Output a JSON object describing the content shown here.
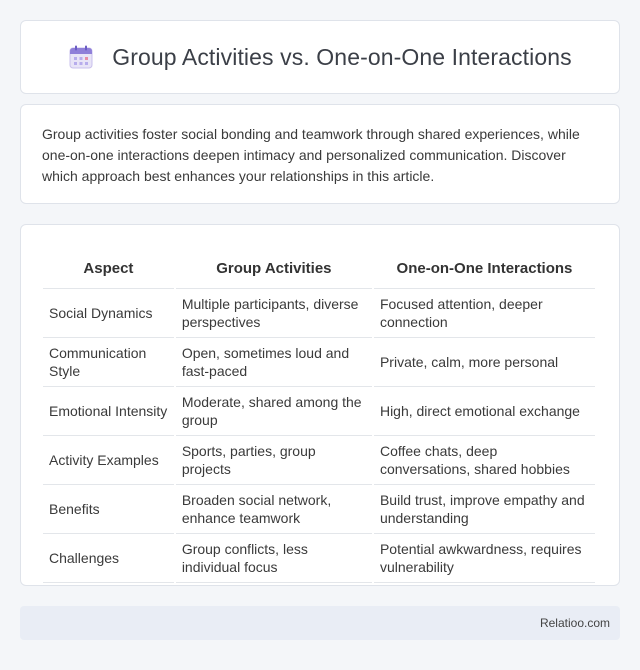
{
  "header": {
    "title": "Group Activities vs. One-on-One Interactions",
    "icon": "calendar-icon"
  },
  "intro": {
    "text": "Group activities foster social bonding and teamwork through shared experiences, while one-on-one interactions deepen intimacy and personalized communication. Discover which approach best enhances your relationships in this article."
  },
  "table": {
    "headers": [
      "Aspect",
      "Group Activities",
      "One-on-One Interactions"
    ],
    "rows": [
      [
        "Social Dynamics",
        "Multiple participants, diverse perspectives",
        "Focused attention, deeper connection"
      ],
      [
        "Communication Style",
        "Open, sometimes loud and fast-paced",
        "Private, calm, more personal"
      ],
      [
        "Emotional Intensity",
        "Moderate, shared among the group",
        "High, direct emotional exchange"
      ],
      [
        "Activity Examples",
        "Sports, parties, group projects",
        "Coffee chats, deep conversations, shared hobbies"
      ],
      [
        "Benefits",
        "Broaden social network, enhance teamwork",
        "Build trust, improve empathy and understanding"
      ],
      [
        "Challenges",
        "Group conflicts, less individual focus",
        "Potential awkwardness, requires vulnerability"
      ]
    ]
  },
  "footer": {
    "text": "Relatioo.com"
  }
}
